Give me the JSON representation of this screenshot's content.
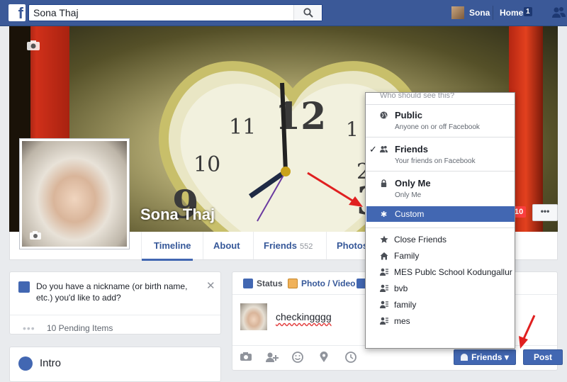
{
  "topbar": {
    "logo_letter": "f",
    "search_value": "Sona Thaj",
    "user_name": "Sona",
    "home_label": "Home",
    "home_count": "1"
  },
  "profile": {
    "name": "Sona Thaj",
    "nav": {
      "timeline": "Timeline",
      "about": "About",
      "friends": "Friends",
      "friends_count": "552",
      "photos": "Photos"
    },
    "notif_count": "10",
    "more_label": "•••"
  },
  "nickname_card": {
    "text": "Do you have a nickname (or birth name, etc.) you'd like to add?",
    "close": "✕",
    "pending_dots": "•••",
    "pending_text": "10 Pending Items"
  },
  "intro": {
    "title": "Intro"
  },
  "composer": {
    "tabs": {
      "status": "Status",
      "photo_video": "Photo / Video"
    },
    "text": "checkingggg",
    "audience_label": "Friends ▾",
    "post_label": "Post"
  },
  "privacy_menu": {
    "header": "Who should see this?",
    "options": [
      {
        "title": "Public",
        "sub": "Anyone on or off Facebook",
        "icon": "globe-icon"
      },
      {
        "title": "Friends",
        "sub": "Your friends on Facebook",
        "icon": "friends-icon",
        "checked": true
      },
      {
        "title": "Only Me",
        "sub": "Only Me",
        "icon": "lock-icon"
      }
    ],
    "custom": "Custom",
    "lists": [
      {
        "title": "Close Friends",
        "icon": "star-icon"
      },
      {
        "title": "Family",
        "icon": "house-icon"
      },
      {
        "title": "MES Publc School Kodungallur T...",
        "icon": "school-list-icon"
      },
      {
        "title": "bvb",
        "icon": "list-icon"
      },
      {
        "title": "family",
        "icon": "list-icon"
      },
      {
        "title": "mes",
        "icon": "list-icon"
      }
    ],
    "check_mark": "✓"
  },
  "colors": {
    "brand_blue": "#3b5998",
    "button_blue": "#4267b2",
    "alert_red": "#fa3e3e",
    "annotation_red": "#e02020"
  }
}
